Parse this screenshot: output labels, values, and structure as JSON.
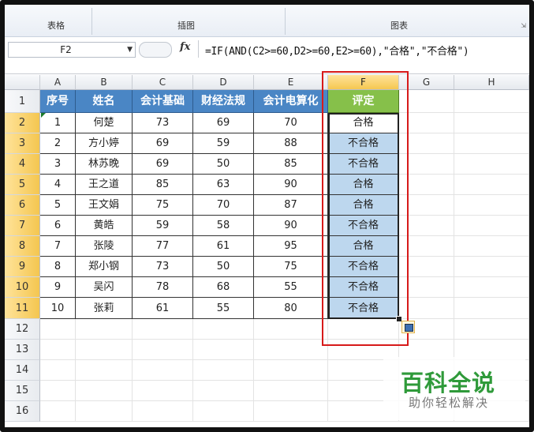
{
  "ribbon": {
    "groups": [
      "表格",
      "插图",
      "图表"
    ]
  },
  "formula_bar": {
    "name_box": "F2",
    "fx_symbol": "fx",
    "formula": "=IF(AND(C2>=60,D2>=60,E2>=60),\"合格\",\"不合格\")"
  },
  "columns": [
    "A",
    "B",
    "C",
    "D",
    "E",
    "F",
    "G",
    "H"
  ],
  "row_numbers": [
    "1",
    "2",
    "3",
    "4",
    "5",
    "6",
    "7",
    "8",
    "9",
    "10",
    "11",
    "12",
    "13",
    "14",
    "15",
    "16"
  ],
  "table": {
    "headers": [
      "序号",
      "姓名",
      "会计基础",
      "财经法规",
      "会计电算化",
      "评定"
    ],
    "rows": [
      [
        "1",
        "何楚",
        "73",
        "69",
        "70",
        "合格"
      ],
      [
        "2",
        "方小婷",
        "69",
        "59",
        "88",
        "不合格"
      ],
      [
        "3",
        "林苏晚",
        "69",
        "50",
        "85",
        "不合格"
      ],
      [
        "4",
        "王之道",
        "85",
        "63",
        "90",
        "合格"
      ],
      [
        "5",
        "王文娟",
        "75",
        "70",
        "87",
        "合格"
      ],
      [
        "6",
        "黄皓",
        "59",
        "58",
        "90",
        "不合格"
      ],
      [
        "7",
        "张陵",
        "77",
        "61",
        "95",
        "合格"
      ],
      [
        "8",
        "郑小钢",
        "73",
        "50",
        "75",
        "不合格"
      ],
      [
        "9",
        "吴闪",
        "78",
        "68",
        "55",
        "不合格"
      ],
      [
        "10",
        "张莉",
        "61",
        "55",
        "80",
        "不合格"
      ]
    ]
  },
  "watermark": {
    "title": "百科全说",
    "subtitle": "助你轻松解决"
  },
  "colors": {
    "header_blue": "#4a86c5",
    "header_green": "#86c04a",
    "selection_fill": "#bdd7ee",
    "highlight_red": "#d71a1a",
    "watermark_green": "#2f9a3a"
  },
  "icons": [
    "dropdown-arrow-icon",
    "function-icon",
    "autofill-options-icon",
    "dialog-launcher-icon"
  ]
}
